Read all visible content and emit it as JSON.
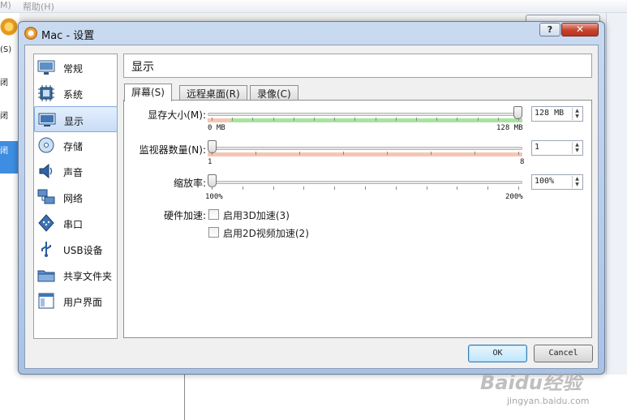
{
  "background": {
    "menu_left": "M)",
    "menu_help": "帮助(H)",
    "left_labels": [
      "(S)",
      "闭",
      "闭",
      "闭"
    ]
  },
  "dialog": {
    "title": "Mac - 设置",
    "help_button": "?",
    "close_button": "✕"
  },
  "sidebar": {
    "items": [
      {
        "label": "常规",
        "icon": "monitor-general-icon"
      },
      {
        "label": "系统",
        "icon": "chip-system-icon"
      },
      {
        "label": "显示",
        "icon": "display-icon"
      },
      {
        "label": "存储",
        "icon": "storage-disc-icon"
      },
      {
        "label": "声音",
        "icon": "speaker-icon"
      },
      {
        "label": "网络",
        "icon": "network-icon"
      },
      {
        "label": "串口",
        "icon": "serial-port-icon"
      },
      {
        "label": "USB设备",
        "icon": "usb-icon"
      },
      {
        "label": "共享文件夹",
        "icon": "shared-folder-icon"
      },
      {
        "label": "用户界面",
        "icon": "user-interface-icon"
      }
    ],
    "selected_index": 2
  },
  "header": {
    "title": "显示"
  },
  "tabs": [
    {
      "label": "屏幕(S)",
      "active": true
    },
    {
      "label": "远程桌面(R)",
      "active": false
    },
    {
      "label": "录像(C)",
      "active": false
    }
  ],
  "screen": {
    "video_memory": {
      "label": "显存大小(M):",
      "value": "128 MB",
      "min": "0 MB",
      "max": "128 MB",
      "fraction": 1.0
    },
    "monitor_count": {
      "label": "监视器数量(N):",
      "value": "1",
      "min": "1",
      "max": "8",
      "fraction": 0.0
    },
    "scale_factor": {
      "label": "缩放率:",
      "value": "100%",
      "min": "100%",
      "max": "200%",
      "fraction": 0.0
    },
    "acceleration": {
      "label": "硬件加速:",
      "enable_3d": {
        "label": "启用3D加速(3)",
        "checked": false
      },
      "enable_2d": {
        "label": "启用2D视频加速(2)",
        "checked": false
      }
    }
  },
  "buttons": {
    "ok": "OK",
    "cancel": "Cancel"
  },
  "watermark": {
    "text": "Baidu经验",
    "sub": "jingyan.baidu.com"
  },
  "colors": {
    "accent": "#3d8ee3",
    "close": "#c7422c",
    "good_band": "#a8e4a0",
    "bad_band": "#f6c6b4"
  }
}
